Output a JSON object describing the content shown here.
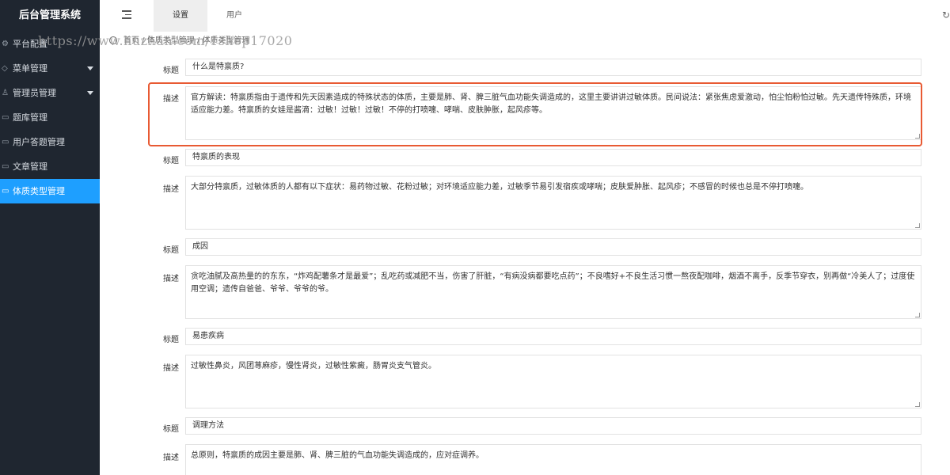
{
  "sidebar": {
    "logo": "后台管理系统",
    "items": [
      {
        "label": "平台配置",
        "icon": "gear-icon",
        "has_arrow": false,
        "active": false
      },
      {
        "label": "菜单管理",
        "icon": "diamond-icon",
        "has_arrow": true,
        "active": false
      },
      {
        "label": "管理员管理",
        "icon": "user-icon",
        "has_arrow": true,
        "active": false
      },
      {
        "label": "题库管理",
        "icon": "doc-icon",
        "has_arrow": false,
        "active": false
      },
      {
        "label": "用户答题管理",
        "icon": "doc-icon",
        "has_arrow": false,
        "active": false
      },
      {
        "label": "文章管理",
        "icon": "doc-icon",
        "has_arrow": false,
        "active": false
      },
      {
        "label": "体质类型管理",
        "icon": "doc-icon",
        "has_arrow": false,
        "active": true
      }
    ],
    "active_color": "#1e9fff",
    "bg_color": "#1f2630"
  },
  "topbar": {
    "tabs": [
      {
        "label": "设置",
        "active": true
      },
      {
        "label": "用户",
        "active": false
      }
    ]
  },
  "breadcrumb": {
    "text": "首页 / 体质类型管理 / 体质类型管理"
  },
  "watermark": "https://www.huzhan.com/1shop17020",
  "form": {
    "title_label": "标题",
    "desc_label": "描述",
    "sections": [
      {
        "title": "什么是特禀质?",
        "desc": "官方解读：特禀质指由于遗传和先天因素造成的特殊状态的体质，主要是肺、肾、脾三脏气血功能失调造成的，这里主要讲讲过敏体质。民间说法：紧张焦虑爱激动，怕尘怕粉怕过敏。先天遗传特殊质，环境适应能力差。特禀质的女娃是酱滴：过敏！过敏！过敏！不停的打喷嚏、哮喘、皮肤肿胀，起风疹等。"
      },
      {
        "title": "特禀质的表现",
        "desc": "大部分特禀质，过敏体质的人都有以下症状：易药物过敏、花粉过敏；对环境适应能力差，过敏季节易引发宿疾或哮喘；皮肤爱肿胀、起风疹；不感冒的时候也总是不停打喷嚏。"
      },
      {
        "title": "成因",
        "desc": "贪吃油腻及高热量的的东东，“炸鸡配薯条才是最爱”；乱吃药或减肥不当，伤害了肝脏，“有病没病都要吃点药”；不良嗜好+不良生活习惯一熬夜配咖啡，烟酒不离手，反季节穿衣，别再做“冷美人了；过度使用空调；遗传自爸爸、爷爷、爷爷的爷。"
      },
      {
        "title": "易患疾病",
        "desc": "过敏性鼻炎，风团荨麻疹，慢性肾炎，过敏性紫癜，肠胃炎支气管炎。"
      },
      {
        "title": "调理方法",
        "desc": "总原则，特禀质的成因主要是肺、肾、脾三脏的气血功能失调造成的，应对症调养。"
      }
    ],
    "highlight_color": "#e85a33"
  }
}
